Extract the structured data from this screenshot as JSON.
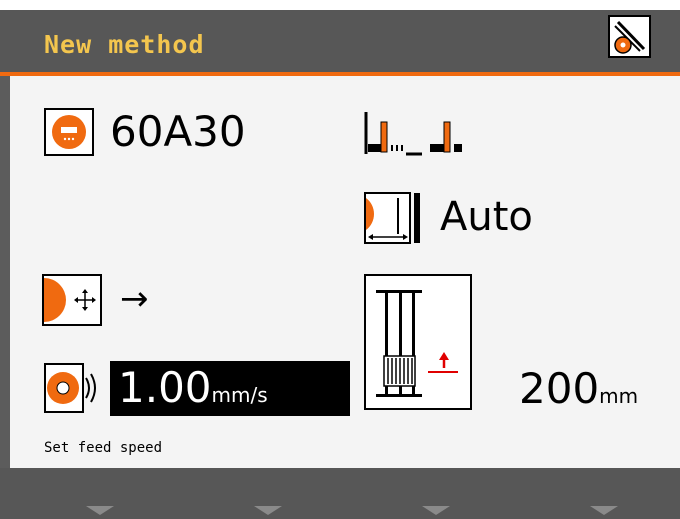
{
  "header": {
    "title": "New method",
    "corner_icon": "method-settings-icon"
  },
  "main": {
    "grain": {
      "icon": "grinding-wheel-icon",
      "value": "60A30"
    },
    "dressing": {
      "icon": "dressing-position-icon"
    },
    "width": {
      "icon": "wheel-width-icon",
      "value": "Auto"
    },
    "direction": {
      "icon": "wheel-direction-icon",
      "arrow": "→"
    },
    "feed": {
      "icon": "feed-speed-icon",
      "value": "1.00",
      "unit": "mm/s"
    },
    "distance": {
      "icon": "stroke-distance-icon",
      "value": "200",
      "unit": "mm"
    },
    "hint": "Set feed speed"
  },
  "footer": {
    "softkeys": [
      "softkey-1",
      "softkey-2",
      "softkey-3",
      "softkey-4"
    ]
  },
  "colors": {
    "accent": "#f06a10",
    "title": "#f4c64e",
    "header_bg": "#575757",
    "content_bg": "#f4f4f4",
    "indicator_red": "#e00000"
  }
}
